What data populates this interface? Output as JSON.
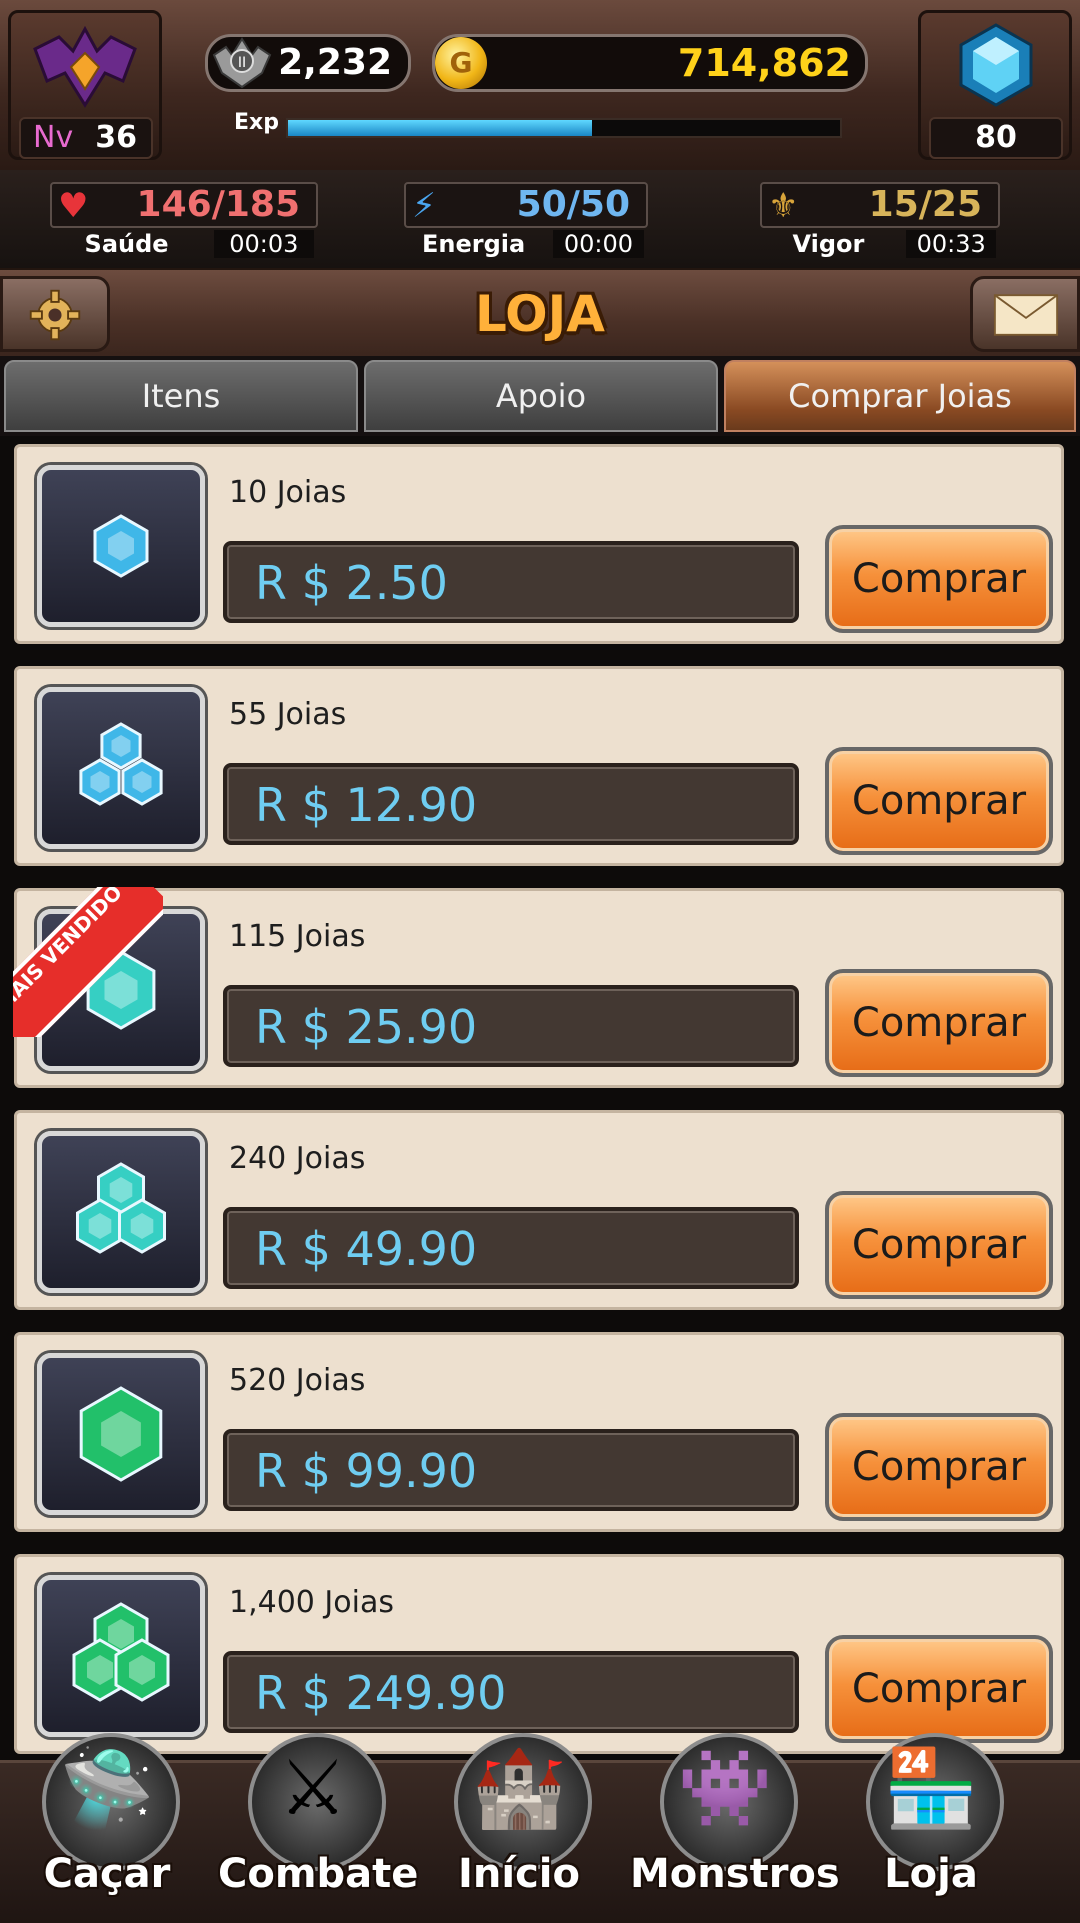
{
  "header": {
    "level_label": "Nv",
    "level": "36",
    "rank_value": "2,232",
    "gold_value": "714,862",
    "exp_label": "Exp",
    "exp_progress_percent": 55,
    "gems": "80"
  },
  "stats": [
    {
      "label": "Saúde",
      "value": "146/185",
      "timer": "00:03",
      "icon": "heart-icon",
      "color": "#f06c6c"
    },
    {
      "label": "Energia",
      "value": "50/50",
      "timer": "00:00",
      "icon": "energy-icon",
      "color": "#6fb6f0"
    },
    {
      "label": "Vigor",
      "value": "15/25",
      "timer": "00:33",
      "icon": "vigor-icon",
      "color": "#d8b45a"
    }
  ],
  "title": "LOJA",
  "tabs": [
    {
      "label": "Itens",
      "active": false
    },
    {
      "label": "Apoio",
      "active": false
    },
    {
      "label": "Comprar Joias",
      "active": true
    }
  ],
  "offers": [
    {
      "qty": "10 Joias",
      "price": "R $  2.50",
      "button": "Comprar",
      "gem_color": "#3fb7e8",
      "gem_count": 1
    },
    {
      "qty": "55 Joias",
      "price": "R $  12.90",
      "button": "Comprar",
      "gem_color": "#3fb7e8",
      "gem_count": 3
    },
    {
      "qty": "115 Joias",
      "price": "R $  25.90",
      "button": "Comprar",
      "gem_color": "#36cfc3",
      "gem_count": 1,
      "badge": "MAIS VENDIDO"
    },
    {
      "qty": "240 Joias",
      "price": "R $  49.90",
      "button": "Comprar",
      "gem_color": "#36cfc3",
      "gem_count": 3
    },
    {
      "qty": "520 Joias",
      "price": "R $  99.90",
      "button": "Comprar",
      "gem_color": "#22c06a",
      "gem_count": 1
    },
    {
      "qty": "1,400 Joias",
      "price": "R $  249.90",
      "button": "Comprar",
      "gem_color": "#22c06a",
      "gem_count": 3
    }
  ],
  "nav": [
    {
      "label": "Caçar",
      "icon": "hunt-icon",
      "glyph": "🛸"
    },
    {
      "label": "Combate",
      "icon": "combat-icon",
      "glyph": "⚔"
    },
    {
      "label": "Início",
      "icon": "castle-icon",
      "glyph": "🏰"
    },
    {
      "label": "Monstros",
      "icon": "monster-icon",
      "glyph": "👾"
    },
    {
      "label": "Loja",
      "icon": "shop-icon",
      "glyph": "🏪"
    }
  ]
}
